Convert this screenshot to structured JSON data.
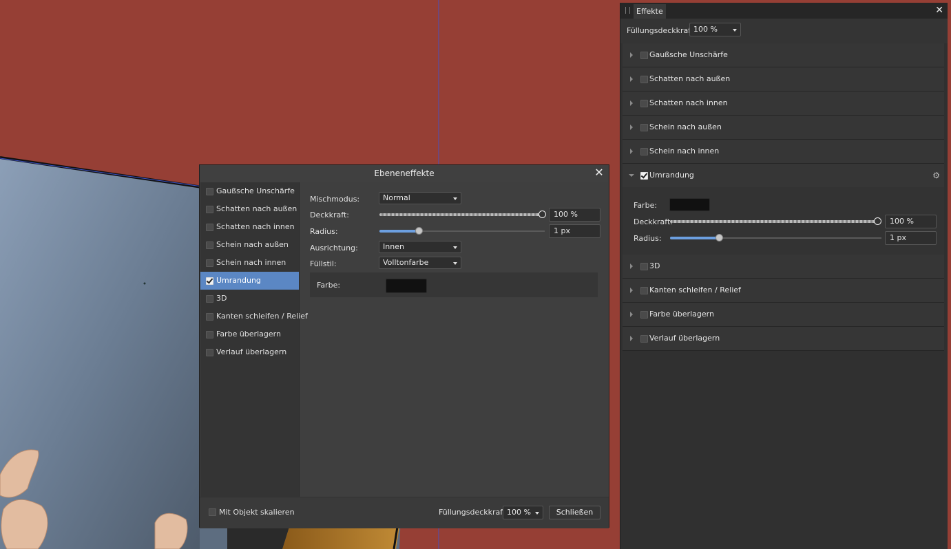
{
  "dialog": {
    "title": "Ebeneneffekte",
    "close_glyph": "✕",
    "effects": [
      {
        "label": "Gaußsche Unschärfe",
        "checked": false
      },
      {
        "label": "Schatten nach außen",
        "checked": false
      },
      {
        "label": "Schatten nach innen",
        "checked": false
      },
      {
        "label": "Schein nach außen",
        "checked": false
      },
      {
        "label": "Schein nach innen",
        "checked": false
      },
      {
        "label": "Umrandung",
        "checked": true,
        "selected": true
      },
      {
        "label": "3D",
        "checked": false
      },
      {
        "label": "Kanten schleifen / Relief",
        "checked": false
      },
      {
        "label": "Farbe überlagern",
        "checked": false
      },
      {
        "label": "Verlauf überlagern",
        "checked": false
      }
    ],
    "settings": {
      "blend_mode_label": "Mischmodus:",
      "blend_mode_value": "Normal",
      "opacity_label": "Deckkraft:",
      "opacity_value": "100 %",
      "opacity_fraction": 1.0,
      "radius_label": "Radius:",
      "radius_value": "1 px",
      "radius_fraction": 0.23,
      "alignment_label": "Ausrichtung:",
      "alignment_value": "Innen",
      "fill_style_label": "Füllstil:",
      "fill_style_value": "Volltonfarbe",
      "color_label": "Farbe:",
      "color_value": "#111111"
    },
    "footer": {
      "scale_with_object_label": "Mit Objekt skalieren",
      "scale_with_object_checked": false,
      "fill_opacity_label": "Füllungsdeckkraft:",
      "fill_opacity_value": "100 %",
      "close_button_label": "Schließen"
    }
  },
  "panel": {
    "tab_label": "Effekte",
    "close_glyph": "✕",
    "fill_opacity_label": "Füllungsdeckkraft:",
    "fill_opacity_value": "100 %",
    "effects_before": [
      {
        "label": "Gaußsche Unschärfe",
        "checked": false
      },
      {
        "label": "Schatten nach außen",
        "checked": false
      },
      {
        "label": "Schatten nach innen",
        "checked": false
      },
      {
        "label": "Schein nach außen",
        "checked": false
      },
      {
        "label": "Schein nach innen",
        "checked": false
      }
    ],
    "expanded": {
      "label": "Umrandung",
      "checked": true,
      "settings_icon": "gear-icon",
      "color_label": "Farbe:",
      "color_value": "#111111",
      "opacity_label": "Deckkraft:",
      "opacity_value": "100 %",
      "opacity_fraction": 1.0,
      "radius_label": "Radius:",
      "radius_value": "1 px",
      "radius_fraction": 0.23
    },
    "effects_after": [
      {
        "label": "3D",
        "checked": false
      },
      {
        "label": "Kanten schleifen / Relief",
        "checked": false
      },
      {
        "label": "Farbe überlagern",
        "checked": false
      },
      {
        "label": "Verlauf überlagern",
        "checked": false
      }
    ]
  },
  "colors": {
    "canvas_background": "#963f35",
    "selection_accent": "#5b87c4",
    "slider_accent": "#6c9fe0"
  }
}
